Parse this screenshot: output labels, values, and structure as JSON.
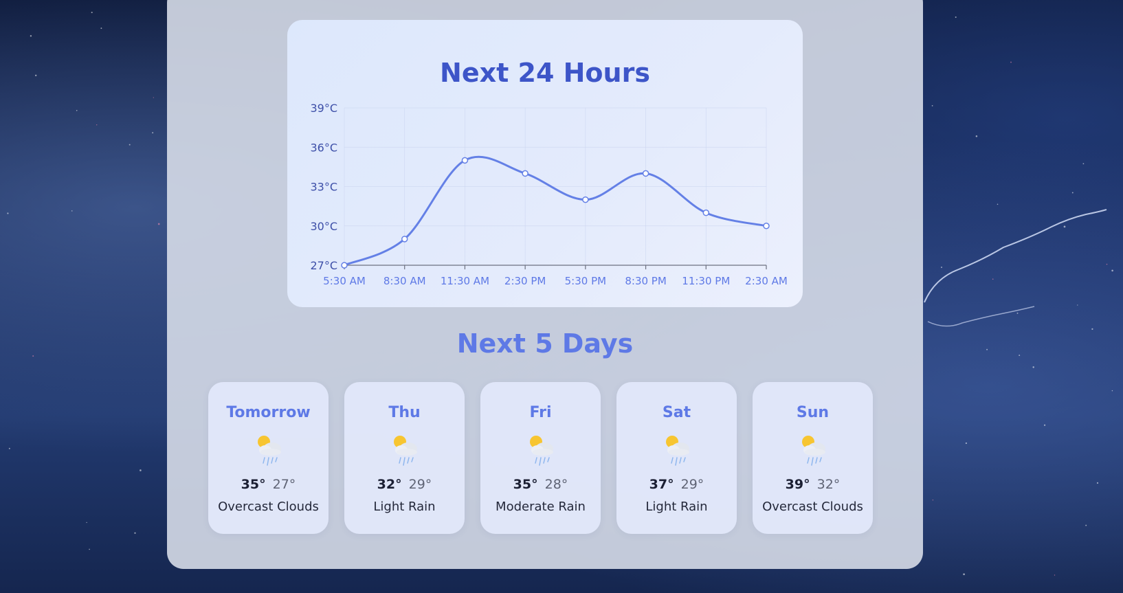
{
  "hourly": {
    "title": "Next 24 Hours"
  },
  "chart_data": {
    "type": "line",
    "title": "Next 24 Hours",
    "x": [
      "5:30 AM",
      "8:30 AM",
      "11:30 AM",
      "2:30 PM",
      "5:30 PM",
      "8:30 PM",
      "11:30 PM",
      "2:30 AM"
    ],
    "series": [
      {
        "values": [
          27,
          29,
          35,
          34,
          32,
          34,
          31,
          30
        ]
      }
    ],
    "ylim": [
      27,
      39
    ],
    "yticks": [
      27,
      30,
      33,
      36,
      39
    ],
    "ytick_labels": [
      "27°C",
      "30°C",
      "33°C",
      "36°C",
      "39°C"
    ],
    "grid": true,
    "colors": {
      "line": "#6480e6",
      "tick_text": "#3d4fa8",
      "x_text": "#5e79e6"
    }
  },
  "forecast": {
    "title": "Next 5 Days",
    "days": [
      {
        "name": "Tomorrow",
        "high": "35°",
        "low": "27°",
        "description": "Overcast Clouds",
        "icon": "sun-cloud-rain-icon"
      },
      {
        "name": "Thu",
        "high": "32°",
        "low": "29°",
        "description": "Light Rain",
        "icon": "sun-cloud-rain-icon"
      },
      {
        "name": "Fri",
        "high": "35°",
        "low": "28°",
        "description": "Moderate Rain",
        "icon": "sun-cloud-rain-icon"
      },
      {
        "name": "Sat",
        "high": "37°",
        "low": "29°",
        "description": "Light Rain",
        "icon": "sun-cloud-rain-icon"
      },
      {
        "name": "Sun",
        "high": "39°",
        "low": "32°",
        "description": "Overcast Clouds",
        "icon": "sun-cloud-rain-icon"
      }
    ]
  },
  "colors": {
    "accent": "#5e79e6",
    "title": "#3d55c8",
    "sun": "#f7c531",
    "cloud": "#e6e9f0",
    "rain": "#8fb7ee"
  }
}
